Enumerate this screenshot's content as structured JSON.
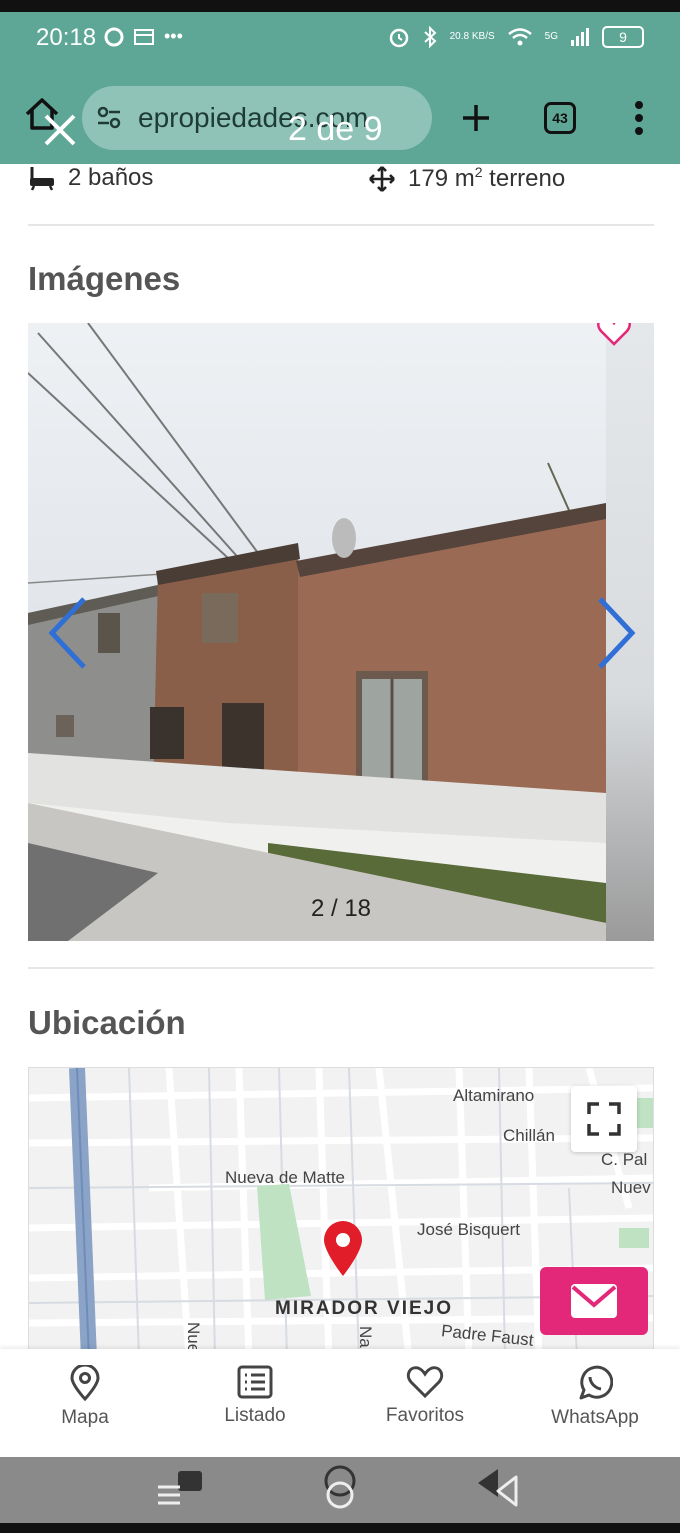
{
  "status_bar": {
    "time": "20:18",
    "net_speed": "20.8 KB/S",
    "signal": "5G",
    "battery": "9"
  },
  "browser": {
    "url": "epropiedades.com",
    "tab_count": "43",
    "overlay_counter": "2 de 9"
  },
  "property": {
    "baths": "2 baños",
    "land_value": "179 m",
    "land_unit_sup": "2",
    "land_label": "terreno"
  },
  "gallery": {
    "title": "Imágenes",
    "counter": "2 / 18"
  },
  "location": {
    "title": "Ubicación",
    "map_labels": {
      "altamirano": "Altamirano",
      "chillan": "Chillán",
      "c_pal": "C. Pal",
      "nuev": "Nuev",
      "nueva_de_matte": "Nueva de Matte",
      "jose_bisquert": "José Bisquert",
      "mirador_viejo": "MIRADOR VIEJO",
      "padre_faust": "Padre Faust",
      "nueva_vertical": "Nueva",
      "na_vertical": "Na"
    }
  },
  "bottom_nav": [
    {
      "label": "Mapa",
      "icon": "map-pin-icon"
    },
    {
      "label": "Listado",
      "icon": "list-icon"
    },
    {
      "label": "Favoritos",
      "icon": "heart-icon"
    },
    {
      "label": "WhatsApp",
      "icon": "whatsapp-icon"
    }
  ],
  "colors": {
    "chrome": "#5ea796",
    "accent": "#e3287a",
    "arrows": "#2f6fd6",
    "pin": "#e11d2a"
  }
}
